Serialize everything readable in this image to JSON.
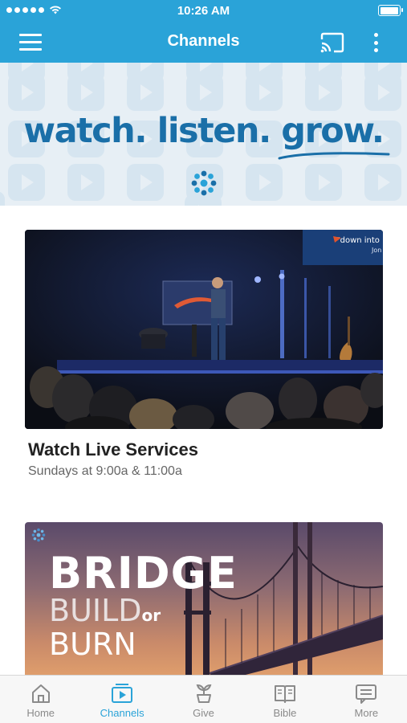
{
  "status_bar": {
    "time": "10:26 AM"
  },
  "header": {
    "title": "Channels",
    "menu_icon": "hamburger-menu-icon",
    "cast_icon": "cast-icon",
    "more_icon": "more-vertical-icon"
  },
  "banner": {
    "headline": "watch. listen. grow."
  },
  "cards": [
    {
      "title": "Watch Live Services",
      "subtitle": "Sundays at 9:00a & 11:00a",
      "screen_text": "\"down into",
      "screen_author": "Jon"
    },
    {
      "title_line1": "BRIDGE",
      "title_line2": "BUILD",
      "title_or": "or",
      "title_line3": "BURN"
    }
  ],
  "tab_bar": {
    "items": [
      {
        "label": "Home",
        "icon": "home-icon",
        "active": false
      },
      {
        "label": "Channels",
        "icon": "play-screen-icon",
        "active": true
      },
      {
        "label": "Give",
        "icon": "plant-icon",
        "active": false
      },
      {
        "label": "Bible",
        "icon": "bible-book-icon",
        "active": false
      },
      {
        "label": "More",
        "icon": "more-list-icon",
        "active": false
      }
    ]
  },
  "colors": {
    "primary": "#2aa3d8",
    "banner_text": "#1a6fa8",
    "inactive_tab": "#8a8a8a"
  }
}
